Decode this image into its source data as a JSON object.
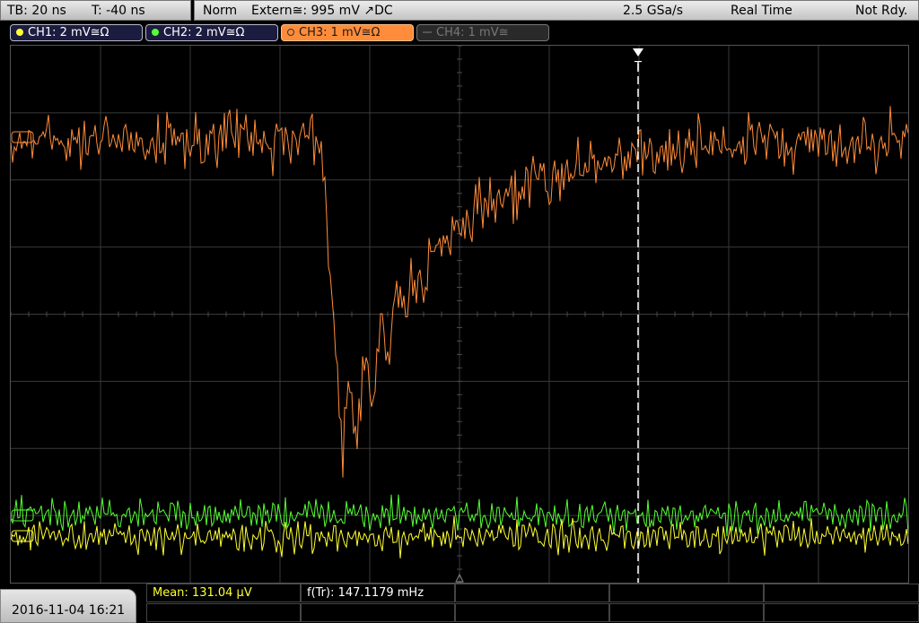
{
  "status": {
    "timebase": "TB: 20 ns",
    "trigger_time": "T: -40 ns",
    "trigger_mode": "Norm",
    "trigger_source": "Extern≅: 995 mV ↗DC",
    "sample_rate": "2.5 GSa/s",
    "acquisition_mode": "Real Time",
    "ready_state": "Not Rdy."
  },
  "channels": [
    {
      "label": "CH1: 2 mV≅Ω",
      "color": "#ffff33"
    },
    {
      "label": "CH2: 2 mV≅Ω",
      "color": "#55ff33"
    },
    {
      "label": "CH3: 1 mV≅Ω",
      "color": "#ff8c3a"
    },
    {
      "label": "CH4: 1 mV≅",
      "color": "#777777"
    }
  ],
  "trigger_marker": "T",
  "datetime": "2016-11-04 16:21",
  "measurements": {
    "mean": "Mean: 131.04 µV",
    "frequency": "f(Tr): 147.1179 mHz"
  },
  "colors": {
    "ch1_trace": "#ffff33",
    "ch2_trace": "#55ff33",
    "ch3_trace": "#ff8c3a",
    "grid": "#3a3a3a"
  }
}
